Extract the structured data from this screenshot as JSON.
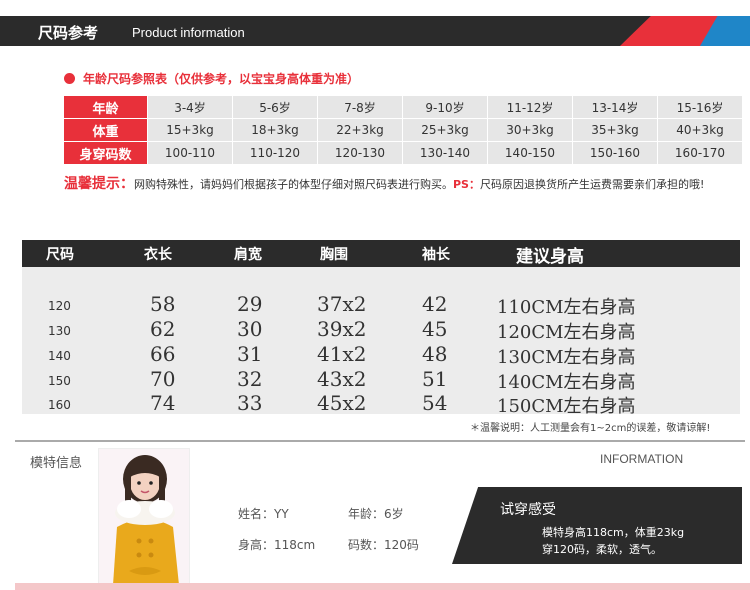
{
  "header": {
    "title_cn": "尺码参考",
    "title_en": "Product information"
  },
  "age_chart": {
    "subtitle": "年龄尺码参照表（仅供参考，以宝宝身高体重为准）",
    "rows": [
      {
        "label": "年龄",
        "cells": [
          "3-4岁",
          "5-6岁",
          "7-8岁",
          "9-10岁",
          "11-12岁",
          "13-14岁",
          "15-16岁"
        ]
      },
      {
        "label": "体重",
        "cells": [
          "15+3kg",
          "18+3kg",
          "22+3kg",
          "25+3kg",
          "30+3kg",
          "35+3kg",
          "40+3kg"
        ]
      },
      {
        "label": "身穿码数",
        "cells": [
          "100-110",
          "110-120",
          "120-130",
          "130-140",
          "140-150",
          "150-160",
          "160-170"
        ]
      }
    ]
  },
  "tip": {
    "title": "温馨提示：",
    "text": "网购特殊性，请妈妈们根据孩子的体型仔细对照尺码表进行购买。",
    "ps_label": "PS：",
    "ps_text": "尺码原因退换货所产生运费需要亲们承担的哦!"
  },
  "size_table": {
    "headers": [
      "尺码",
      "衣长",
      "肩宽",
      "胸围",
      "袖长",
      "建议身高"
    ],
    "rows": [
      [
        "120",
        "58",
        "29",
        "37x2",
        "42",
        "110CM左右身高"
      ],
      [
        "130",
        "62",
        "30",
        "39x2",
        "45",
        "120CM左右身高"
      ],
      [
        "140",
        "66",
        "31",
        "41x2",
        "48",
        "130CM左右身高"
      ],
      [
        "150",
        "70",
        "32",
        "43x2",
        "51",
        "140CM左右身高"
      ],
      [
        "160",
        "74",
        "33",
        "45x2",
        "54",
        "150CM左右身高"
      ]
    ],
    "note": "＊温馨说明：人工测量会有1~2cm的误差，敬请谅解!"
  },
  "model": {
    "title": "模特信息",
    "title_en": "INFORMATION",
    "name_label": "姓名：",
    "name": "YY",
    "age_label": "年龄：",
    "age": "6岁",
    "height_label": "身高：",
    "height": "118cm",
    "size_label": "码数：",
    "size": "120码",
    "feel_title": "试穿感受",
    "feel_line1": "模特身高118cm，体重23kg",
    "feel_line2": "穿120码，柔软，透气。"
  },
  "colors": {
    "accent": "#e8303a",
    "dark": "#2b2b2b",
    "blue": "#1f86c8",
    "coat": "#e9a91c"
  }
}
